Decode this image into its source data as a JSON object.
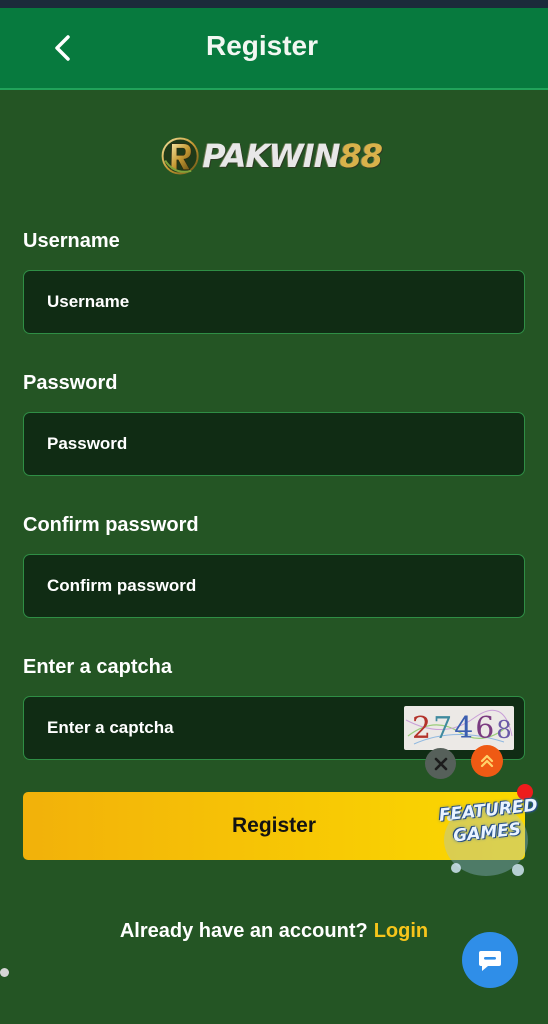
{
  "header": {
    "title": "Register",
    "back_icon": "chevron-left-icon"
  },
  "logo": {
    "text_main": "PAKWIN",
    "text_accent": "88"
  },
  "form": {
    "username": {
      "label": "Username",
      "placeholder": "Username",
      "value": ""
    },
    "password": {
      "label": "Password",
      "placeholder": "Password",
      "value": ""
    },
    "confirm_password": {
      "label": "Confirm password",
      "placeholder": "Confirm password",
      "value": ""
    },
    "captcha": {
      "label": "Enter a captcha",
      "placeholder": "Enter a captcha",
      "value": "",
      "code": "27468"
    },
    "submit_label": "Register"
  },
  "footer": {
    "question": "Already have an account?",
    "login_label": "Login"
  },
  "floating": {
    "featured_line1": "FEATURED",
    "featured_line2": "GAMES",
    "close_icon": "close-icon",
    "scroll_top_icon": "double-chevron-up-icon",
    "chat_icon": "chat-bubble-icon"
  },
  "colors": {
    "background": "#245524",
    "header": "#077a3e",
    "input_bg": "#102c14",
    "input_border": "#2f8e45",
    "button_start": "#f2b10a",
    "button_end": "#fbd900",
    "login_link": "#f7c51b",
    "chat_button": "#2f8ee8",
    "scroll_top": "#ef5a14"
  }
}
